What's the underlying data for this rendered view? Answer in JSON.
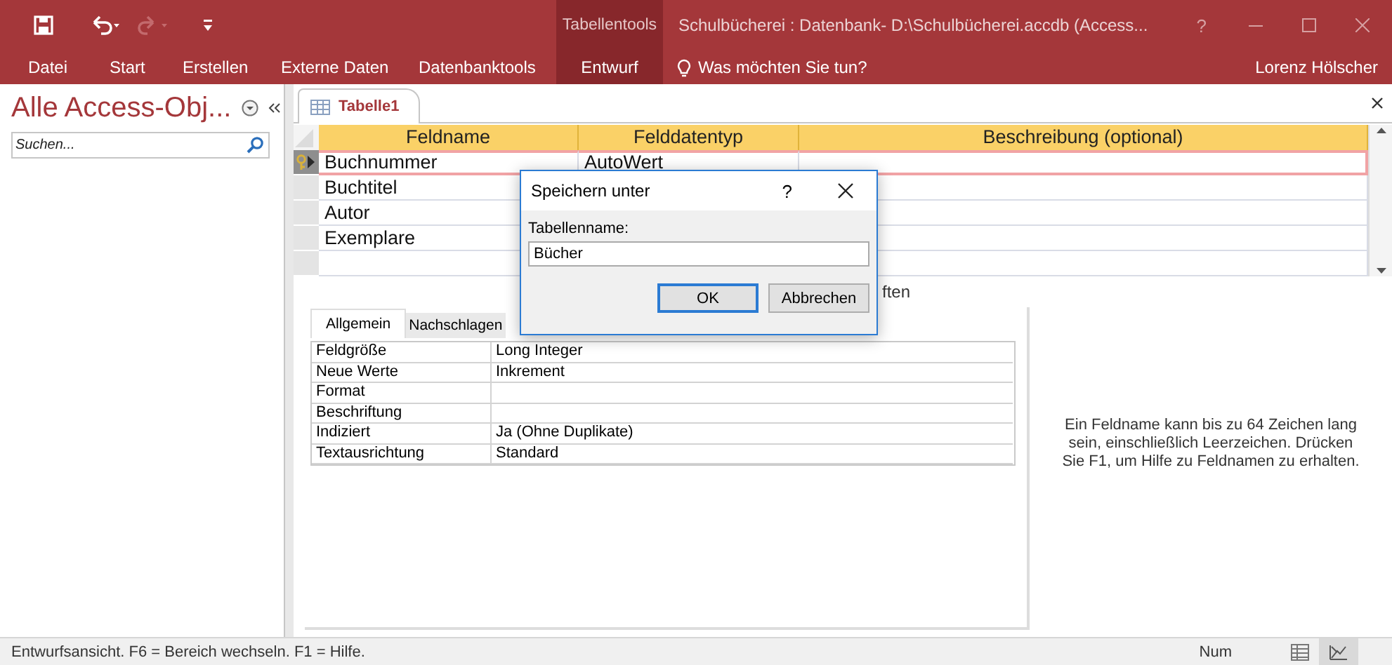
{
  "title_bar": {
    "contextual_group": "Tabellentools",
    "title": "Schulbücherei : Datenbank- D:\\Schulbücherei.accdb (Access...",
    "help": "?"
  },
  "ribbon_tabs": [
    {
      "label": "Datei",
      "selected": false
    },
    {
      "label": "Start",
      "selected": false
    },
    {
      "label": "Erstellen",
      "selected": false
    },
    {
      "label": "Externe Daten",
      "selected": false
    },
    {
      "label": "Datenbanktools",
      "selected": false
    },
    {
      "label": "Entwurf",
      "selected": true
    }
  ],
  "tell_me": "Was möchten Sie tun?",
  "user": "Lorenz Hölscher",
  "navigation_pane": {
    "title": "Alle Access-Obj...",
    "search": {
      "placeholder": "Suchen..."
    }
  },
  "document_tab": {
    "label": "Tabelle1"
  },
  "design_grid": {
    "columns": [
      "Feldname",
      "Felddatentyp",
      "Beschreibung (optional)"
    ],
    "rows": [
      {
        "field_name": "Buchnummer",
        "data_type": "AutoWert",
        "selected": true,
        "primary_key": true
      },
      {
        "field_name": "Buchtitel",
        "selected": false,
        "primary_key": false
      },
      {
        "field_name": "Autor",
        "selected": false,
        "primary_key": false
      },
      {
        "field_name": "Exemplare",
        "selected": false,
        "primary_key": false
      }
    ]
  },
  "field_properties_label": "ften",
  "property_tabs": [
    {
      "label": "Allgemein",
      "selected": true
    },
    {
      "label": "Nachschlagen",
      "selected": false
    }
  ],
  "properties": [
    {
      "name": "Feldgröße",
      "value": "Long Integer"
    },
    {
      "name": "Neue Werte",
      "value": "Inkrement"
    },
    {
      "name": "Format"
    },
    {
      "name": "Beschriftung"
    },
    {
      "name": "Indiziert",
      "value": "Ja (Ohne Duplikate)"
    },
    {
      "name": "Textausrichtung",
      "value": "Standard"
    }
  ],
  "help_text": "Ein Feldname kann bis zu 64 Zeichen lang sein, einschließlich Leerzeichen. Drücken Sie F1, um Hilfe zu Feldnamen zu erhalten.",
  "dialog": {
    "title": "Speichern unter",
    "help": "?",
    "label": "Tabellenname:",
    "value": "Bücher",
    "buttons": [
      {
        "label": "OK",
        "default": true
      },
      {
        "label": "Abbrechen",
        "default": false
      }
    ]
  },
  "status_bar": {
    "text": "Entwurfsansicht. F6 = Bereich wechseln. F1 = Hilfe.",
    "num_lock": "Num"
  }
}
